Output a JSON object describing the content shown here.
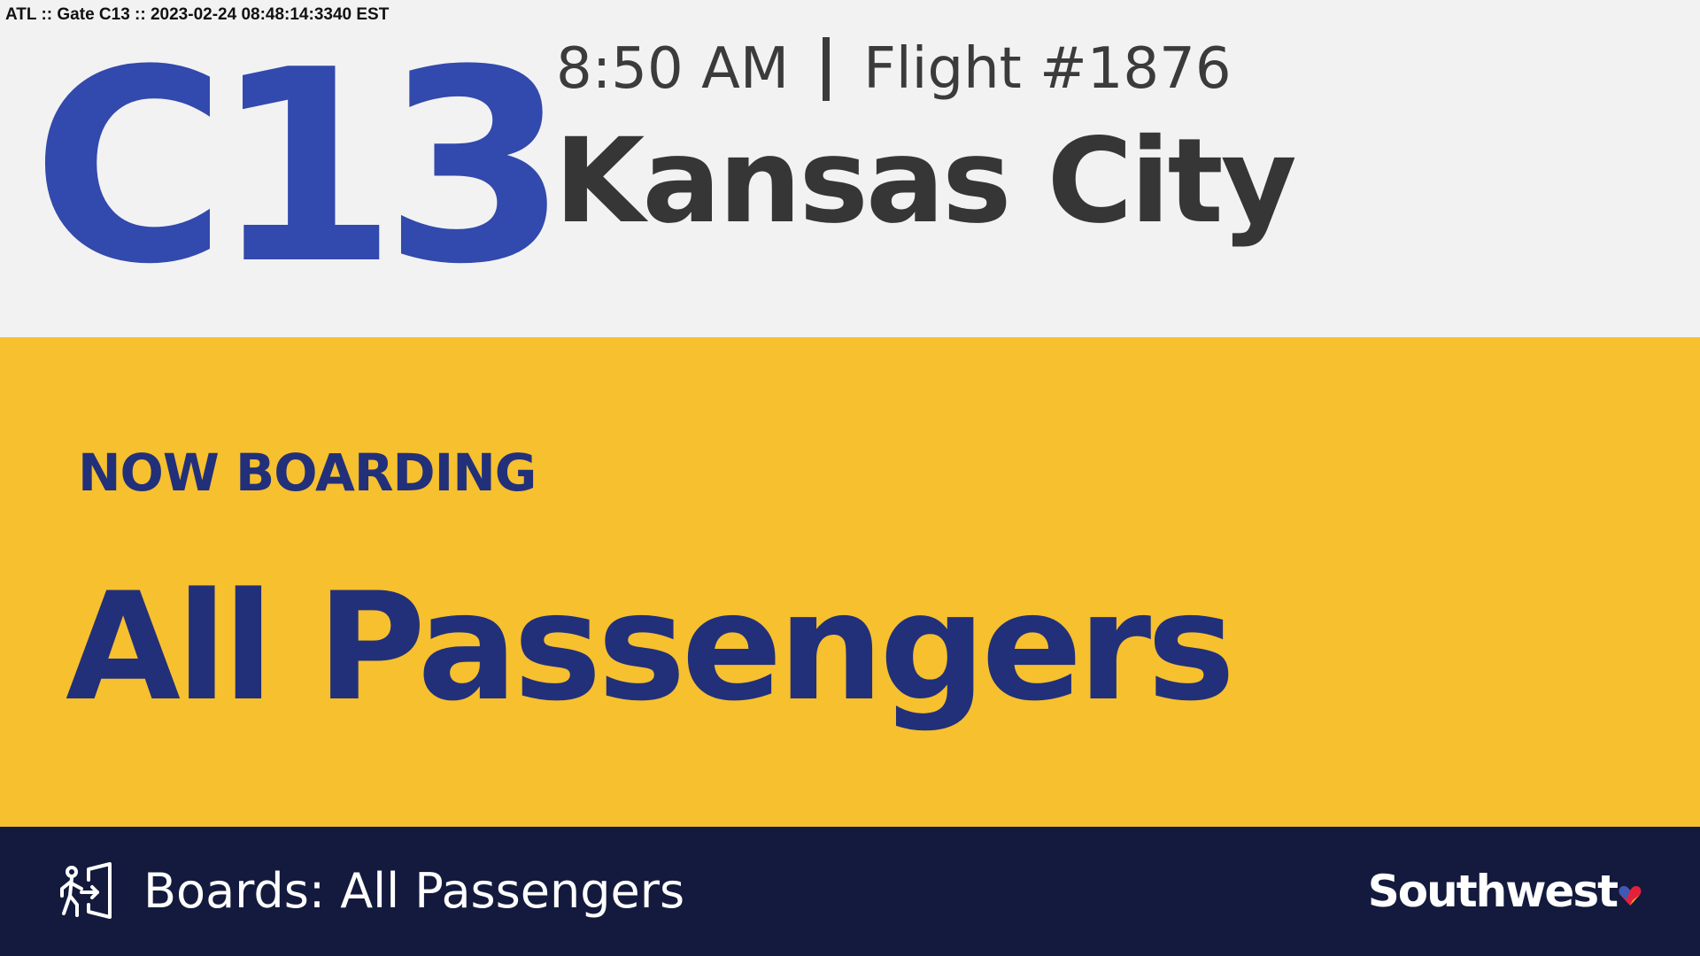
{
  "meta": {
    "status_line": "ATL :: Gate C13 :: 2023-02-24 08:48:14:3340 EST"
  },
  "gate": {
    "number": "C13"
  },
  "flight": {
    "time": "8:50 AM",
    "number": "Flight #1876",
    "destination": "Kansas City"
  },
  "boarding": {
    "status": "NOW BOARDING",
    "group": "All Passengers"
  },
  "footer": {
    "boards_text": "Boards: All Passengers",
    "icon": "boarding-passenger-icon",
    "brand": "Southwest",
    "brand_icon": "southwest-heart-icon"
  },
  "colors": {
    "header_bg": "#f2f2f2",
    "gate_blue": "#3249ad",
    "text_dark": "#363636",
    "boarding_yellow": "#f6c02f",
    "boarding_navy": "#22307a",
    "footer_navy": "#131a3d",
    "heart_red": "#e5213a",
    "heart_blue": "#3d5ab5",
    "heart_yellow": "#f6c02f"
  }
}
